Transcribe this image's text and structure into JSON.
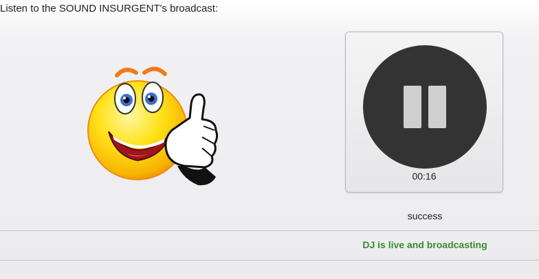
{
  "intro_text": "Listen to the SOUND INSURGENT's broadcast:",
  "mascot": {
    "icon": "thumbs-up-smiley-icon"
  },
  "player": {
    "state": "playing",
    "toggle_icon": "pause-icon",
    "elapsed": "00:16",
    "colors": {
      "button_face": "#333333",
      "pause_bars": "#cfcfcf"
    }
  },
  "status": {
    "text": "success"
  },
  "broadcast": {
    "message": "DJ is live and broadcasting",
    "color": "#3a8a2e"
  }
}
